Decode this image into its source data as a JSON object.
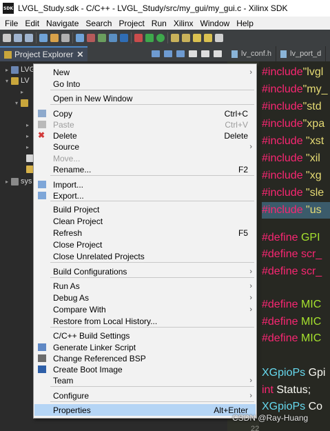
{
  "window": {
    "title": "LVGL_Study.sdk - C/C++ - LVGL_Study/src/my_gui/my_gui.c - Xilinx SDK",
    "logo_text": "SDK"
  },
  "menubar": [
    "File",
    "Edit",
    "Navigate",
    "Search",
    "Project",
    "Run",
    "Xilinx",
    "Window",
    "Help"
  ],
  "project_explorer": {
    "tab_label": "Project Explorer",
    "close_glyph": "✕",
    "tree": [
      {
        "arrow": "▸",
        "label": "LVGL"
      },
      {
        "arrow": "▾",
        "label": "LV"
      },
      {
        "arrow": "▸",
        "label": ""
      },
      {
        "arrow": "▾",
        "label": ""
      },
      {
        "arrow": "▸",
        "label": ""
      },
      {
        "arrow": "▸",
        "label": ""
      },
      {
        "arrow": "▸",
        "label": ""
      },
      {
        "arrow": "",
        "label": ""
      },
      {
        "arrow": "",
        "label": ""
      },
      {
        "arrow": "▸",
        "label": "sys"
      }
    ]
  },
  "editor": {
    "tabs": [
      {
        "label": "lv_conf.h"
      },
      {
        "label": "lv_port_d"
      }
    ],
    "code_lines": [
      {
        "kw": "#include",
        "rest": "\"lvgl",
        "kind": "inc"
      },
      {
        "kw": "#include",
        "rest": "\"my_",
        "kind": "inc"
      },
      {
        "kw": "#include",
        "rest": "\"std",
        "kind": "inc"
      },
      {
        "kw": "#include",
        "rest": "\"xpa",
        "kind": "inc"
      },
      {
        "kw": "#include",
        "rest": " \"xst",
        "kind": "inc"
      },
      {
        "kw": "#include",
        "rest": " \"xil",
        "kind": "inc"
      },
      {
        "kw": "#include",
        "rest": " \"xg",
        "kind": "inc"
      },
      {
        "kw": "#include",
        "rest": " \"sle",
        "kind": "inc"
      },
      {
        "kw": "#include",
        "rest": " \"us",
        "kind": "inc"
      },
      {
        "kw": "#define",
        "rest": " GPI",
        "kind": "defg"
      },
      {
        "kw": "#define",
        "rest": " scr_",
        "kind": "defr"
      },
      {
        "kw": "#define",
        "rest": " scr_",
        "kind": "defr"
      },
      {
        "kw": "#define",
        "rest": " MIC",
        "kind": "defg"
      },
      {
        "kw": "#define",
        "rest": " MIC",
        "kind": "defg"
      },
      {
        "kw": "#define",
        "rest": " MIC",
        "kind": "defg"
      },
      {
        "kw": "XGpioPs",
        "rest": " Gpi",
        "kind": "type"
      },
      {
        "kw": "int",
        "rest": " Status;",
        "kind": "int"
      },
      {
        "kw": "XGpioPs",
        "rest": " Co",
        "kind": "type"
      }
    ],
    "line_number": "22"
  },
  "context_menu": {
    "items": [
      {
        "label": "New",
        "shortcut": "",
        "submenu": true,
        "icon": "",
        "disabled": false
      },
      {
        "label": "Go Into",
        "shortcut": "",
        "submenu": false,
        "icon": "",
        "disabled": false
      },
      {
        "label": "Open in New Window",
        "shortcut": "",
        "submenu": false,
        "icon": "",
        "disabled": false
      },
      {
        "label": "Copy",
        "shortcut": "Ctrl+C",
        "submenu": false,
        "icon": "copy-icon",
        "disabled": false
      },
      {
        "label": "Paste",
        "shortcut": "Ctrl+V",
        "submenu": false,
        "icon": "paste-icon",
        "disabled": true
      },
      {
        "label": "Delete",
        "shortcut": "Delete",
        "submenu": false,
        "icon": "delete-icon",
        "disabled": false
      },
      {
        "label": "Source",
        "shortcut": "",
        "submenu": true,
        "icon": "",
        "disabled": false
      },
      {
        "label": "Move...",
        "shortcut": "",
        "submenu": false,
        "icon": "",
        "disabled": true
      },
      {
        "label": "Rename...",
        "shortcut": "F2",
        "submenu": false,
        "icon": "",
        "disabled": false
      },
      {
        "label": "Import...",
        "shortcut": "",
        "submenu": false,
        "icon": "import-icon",
        "disabled": false
      },
      {
        "label": "Export...",
        "shortcut": "",
        "submenu": false,
        "icon": "export-icon",
        "disabled": false
      },
      {
        "label": "Build Project",
        "shortcut": "",
        "submenu": false,
        "icon": "",
        "disabled": false
      },
      {
        "label": "Clean Project",
        "shortcut": "",
        "submenu": false,
        "icon": "",
        "disabled": false
      },
      {
        "label": "Refresh",
        "shortcut": "F5",
        "submenu": false,
        "icon": "",
        "disabled": false
      },
      {
        "label": "Close Project",
        "shortcut": "",
        "submenu": false,
        "icon": "",
        "disabled": false
      },
      {
        "label": "Close Unrelated Projects",
        "shortcut": "",
        "submenu": false,
        "icon": "",
        "disabled": false
      },
      {
        "label": "Build Configurations",
        "shortcut": "",
        "submenu": true,
        "icon": "",
        "disabled": false
      },
      {
        "label": "Run As",
        "shortcut": "",
        "submenu": true,
        "icon": "",
        "disabled": false
      },
      {
        "label": "Debug As",
        "shortcut": "",
        "submenu": true,
        "icon": "",
        "disabled": false
      },
      {
        "label": "Compare With",
        "shortcut": "",
        "submenu": true,
        "icon": "",
        "disabled": false
      },
      {
        "label": "Restore from Local History...",
        "shortcut": "",
        "submenu": false,
        "icon": "",
        "disabled": false
      },
      {
        "label": "C/C++ Build Settings",
        "shortcut": "",
        "submenu": false,
        "icon": "",
        "disabled": false
      },
      {
        "label": "Generate Linker Script",
        "shortcut": "",
        "submenu": false,
        "icon": "linker-script-icon",
        "disabled": false
      },
      {
        "label": "Change Referenced BSP",
        "shortcut": "",
        "submenu": false,
        "icon": "bsp-icon",
        "disabled": false
      },
      {
        "label": "Create Boot Image",
        "shortcut": "",
        "submenu": false,
        "icon": "boot-image-icon",
        "disabled": false
      },
      {
        "label": "Team",
        "shortcut": "",
        "submenu": true,
        "icon": "",
        "disabled": false
      },
      {
        "label": "Configure",
        "shortcut": "",
        "submenu": true,
        "icon": "",
        "disabled": false
      },
      {
        "label": "Properties",
        "shortcut": "Alt+Enter",
        "submenu": false,
        "icon": "",
        "disabled": false,
        "selected": true
      }
    ],
    "submenu_glyph": "›"
  },
  "watermark": "CSDN @Ray-Huang",
  "colors": {
    "menu_bg": "#f2f2f2",
    "menu_selected": "#b5d5f5",
    "editor_bg": "#272822",
    "include_kw": "#f92672",
    "string": "#e6db74",
    "macro_green": "#a6e22e",
    "type_blue": "#66d9ef"
  }
}
